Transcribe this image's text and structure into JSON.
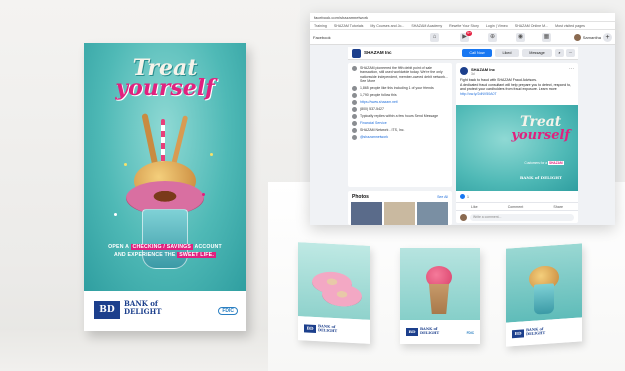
{
  "poster": {
    "title_line1": "Treat",
    "title_line2": "yourself",
    "cta_line1_a": "OPEN A",
    "cta_line1_highlight": "CHECKING / SAVINGS",
    "cta_line1_b": "ACCOUNT",
    "cta_line2_a": "AND EXPERIENCE THE",
    "cta_line2_highlight": "SWEET LIFE.",
    "bank_logo_text": "BD",
    "bank_name_line1": "BANK of",
    "bank_name_line2": "DELIGHT",
    "fdic_text": "FDIC"
  },
  "browser": {
    "url": "facebook.com/shazamnetwork",
    "bookmarks": [
      "Training",
      "SHAZAM Tutorials",
      "My Courses and Jo...",
      "SHAZAM Academy",
      "Rewrite Your Story",
      "Login | Vimeo",
      "SHAZAM Online M...",
      "Most visited pages"
    ],
    "nav_left": "Facebook",
    "nav_badge": "9+",
    "account_name": "Samantha",
    "page_name": "SHAZAM Inc",
    "buttons": {
      "call": "Call Now",
      "like": "Liked",
      "message": "Message",
      "search": "⌕",
      "more": "···"
    },
    "about": [
      {
        "icon": "info-icon",
        "text": "SHAZAM pioneered the fifth debit point of sale transaction, still used worldwide today. We're the only nationwide independent, member-owned debit network... See More",
        "link": false
      },
      {
        "icon": "like-icon",
        "text": "1,865 people like this including 1 of your friends",
        "link": false
      },
      {
        "icon": "follow-icon",
        "text": "1,790 people follow this",
        "link": false
      },
      {
        "icon": "globe-icon",
        "text": "https://www.shazam.net/",
        "link": true
      },
      {
        "icon": "phone-icon",
        "text": "(800) 537-5427",
        "link": false
      },
      {
        "icon": "chat-icon",
        "text": "Typically replies within a few hours Send Message",
        "link": false
      },
      {
        "icon": "tag-icon",
        "text": "Financial Service",
        "link": true
      },
      {
        "icon": "group-icon",
        "text": "SHAZAM Network - ITS, Inc.",
        "link": false
      },
      {
        "icon": "twitter-icon",
        "text": "@shazamnetwork",
        "link": true
      }
    ],
    "photos_title": "Photos",
    "photos_see_all": "See All",
    "post": {
      "name": "SHAZAM Inc",
      "date": "3d",
      "text1": "Fight back to fraud with SHAZAM Fraud Advisors.",
      "text2": "A dedicated fraud consultant will help prepare you to detect, respond to, and protect your cardholders from fraud exposure. Learn more",
      "link": "http://ow.ly/2dNV50A0T",
      "img_title1": "Treat",
      "img_title2": "yourself",
      "img_caption": "Customers for a",
      "img_caption_hl": "SHAZAM",
      "img_bank": "BANK of DELIGHT",
      "reactions": "1",
      "actions": [
        "Like",
        "Comment",
        "Share"
      ],
      "comment_placeholder": "Write a comment..."
    }
  },
  "tents": {
    "logo_text": "BD",
    "bank_line1": "BANK of",
    "bank_line2": "DELIGHT",
    "fdic_text": "FDIC"
  }
}
